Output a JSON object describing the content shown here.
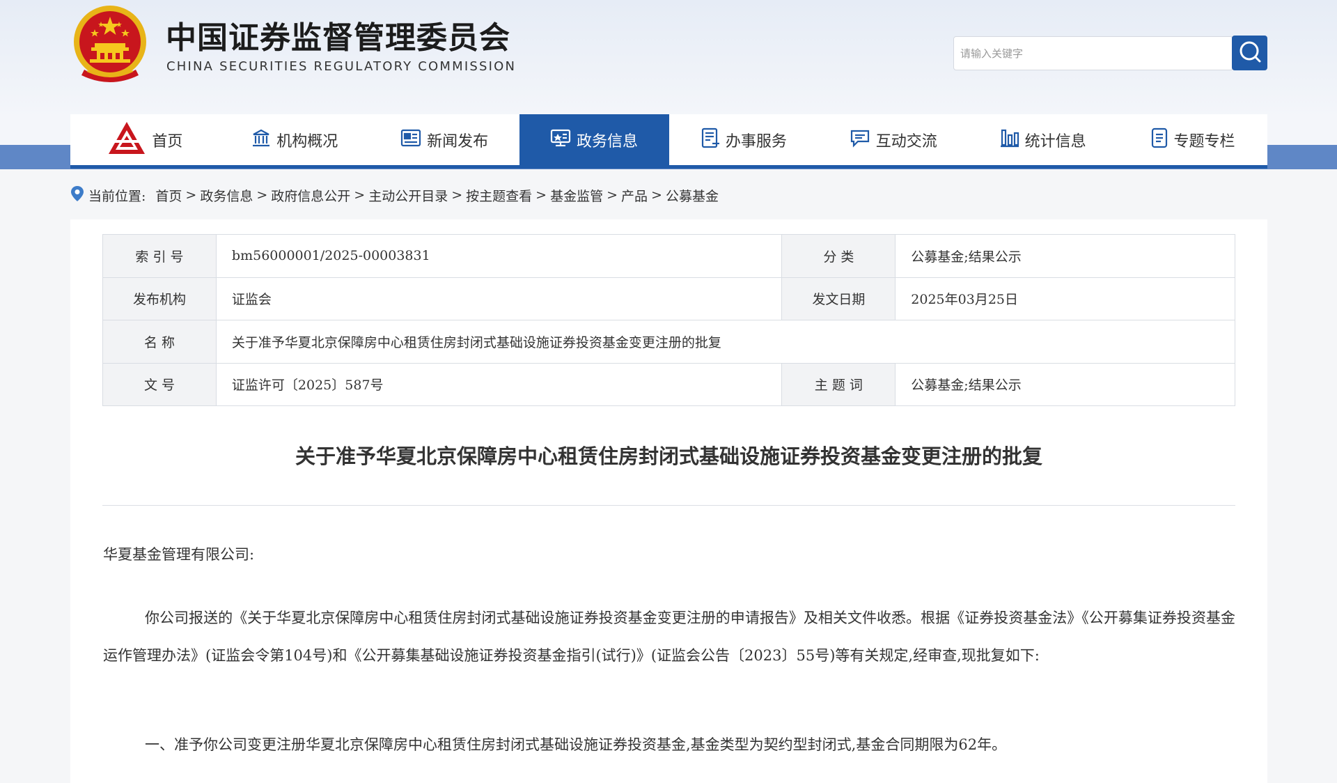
{
  "header": {
    "title_cn": "中国证券监督管理委员会",
    "title_en": "CHINA SECURITIES REGULATORY COMMISSION",
    "search_placeholder": "请输入关键字",
    "emblem_icon": "national-emblem-icon",
    "search_icon": "search-icon"
  },
  "nav": {
    "items": [
      {
        "label": "首页",
        "icon": "csrc-logo-icon"
      },
      {
        "label": "机构概况",
        "icon": "building-icon"
      },
      {
        "label": "新闻发布",
        "icon": "news-icon"
      },
      {
        "label": "政务信息",
        "icon": "monitor-icon",
        "active": true
      },
      {
        "label": "办事服务",
        "icon": "form-icon"
      },
      {
        "label": "互动交流",
        "icon": "chat-icon"
      },
      {
        "label": "统计信息",
        "icon": "bar-chart-icon"
      },
      {
        "label": "专题专栏",
        "icon": "document-icon"
      }
    ]
  },
  "breadcrumb": {
    "prefix": "当前位置:",
    "items": [
      "首页",
      "政务信息",
      "政府信息公开",
      "主动公开目录",
      "按主题查看",
      "基金监管",
      "产品",
      "公募基金"
    ],
    "separator": ">"
  },
  "meta": {
    "index_label": "索 引 号",
    "index_value": "bm56000001/2025-00003831",
    "category_label": "分 类",
    "category_value": "公募基金;结果公示",
    "publisher_label": "发布机构",
    "publisher_value": "证监会",
    "date_label": "发文日期",
    "date_value": "2025年03月25日",
    "name_label": "名 称",
    "name_value": "关于准予华夏北京保障房中心租赁住房封闭式基础设施证券投资基金变更注册的批复",
    "docno_label": "文 号",
    "docno_value": "证监许可〔2025〕587号",
    "keywords_label": "主 题 词",
    "keywords_value": "公募基金;结果公示"
  },
  "document": {
    "title": "关于准予华夏北京保障房中心租赁住房封闭式基础设施证券投资基金变更注册的批复",
    "salutation": "华夏基金管理有限公司:",
    "paragraph_1": "你公司报送的《关于华夏北京保障房中心租赁住房封闭式基础设施证券投资基金变更注册的申请报告》及相关文件收悉。根据《证券投资基金法》《公开募集证券投资基金运作管理办法》(证监会令第104号)和《公开募集基础设施证券投资基金指引(试行)》(证监会公告〔2023〕55号)等有关规定,经审查,现批复如下:",
    "item_1": "一、准予你公司变更注册华夏北京保障房中心租赁住房封闭式基础设施证券投资基金,基金类型为契约型封闭式,基金合同期限为62年。"
  },
  "colors": {
    "primary_blue": "#1f5aa8",
    "strip_blue": "#5f87c6",
    "emblem_red": "#c8161d",
    "emblem_gold": "#e8b418"
  }
}
